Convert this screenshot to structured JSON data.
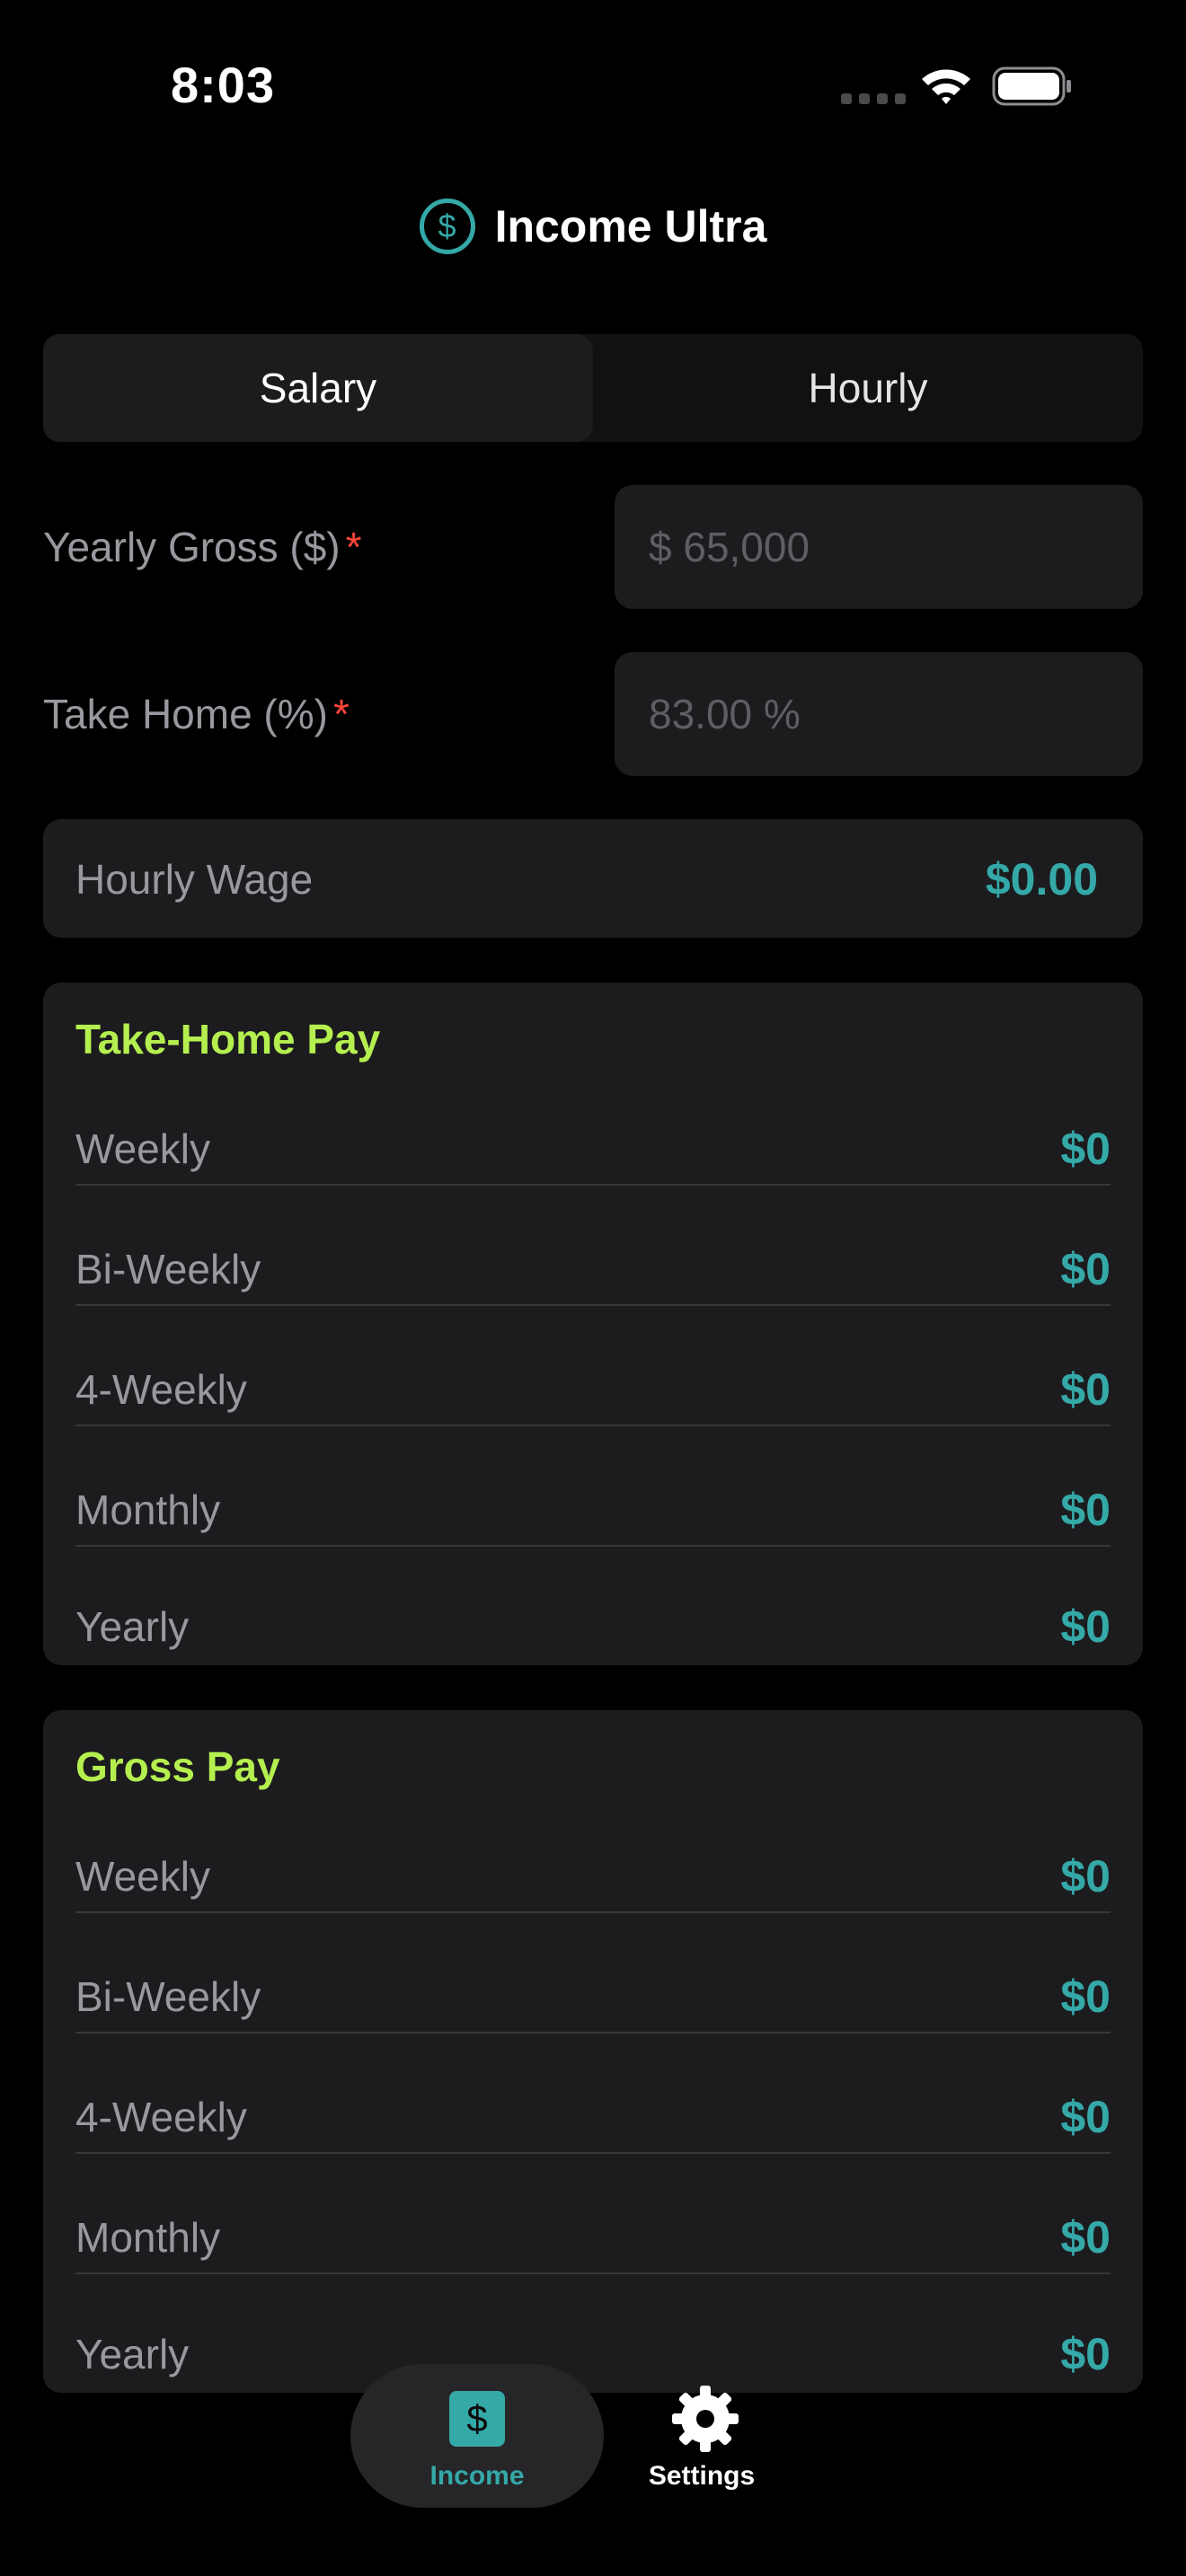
{
  "status_bar": {
    "time": "8:03"
  },
  "header": {
    "title": "Income Ultra",
    "icon": "dollar-circle-icon"
  },
  "segment": {
    "salary_label": "Salary",
    "hourly_label": "Hourly",
    "selected": "Salary"
  },
  "fields": {
    "yearly_gross": {
      "label": "Yearly Gross ($)",
      "required_mark": "*",
      "placeholder": "$ 65,000"
    },
    "take_home": {
      "label": "Take Home (%)",
      "required_mark": "*",
      "placeholder": "83.00 %"
    }
  },
  "hourly_wage": {
    "label": "Hourly Wage",
    "value": "$0.00"
  },
  "take_home_pay": {
    "title": "Take-Home Pay",
    "rows": [
      {
        "label": "Weekly",
        "value": "$0"
      },
      {
        "label": "Bi-Weekly",
        "value": "$0"
      },
      {
        "label": "4-Weekly",
        "value": "$0"
      },
      {
        "label": "Monthly",
        "value": "$0"
      },
      {
        "label": "Yearly",
        "value": "$0"
      }
    ]
  },
  "gross_pay": {
    "title": "Gross Pay",
    "rows": [
      {
        "label": "Weekly",
        "value": "$0"
      },
      {
        "label": "Bi-Weekly",
        "value": "$0"
      },
      {
        "label": "4-Weekly",
        "value": "$0"
      },
      {
        "label": "Monthly",
        "value": "$0"
      },
      {
        "label": "Yearly",
        "value": "$0"
      }
    ]
  },
  "tab_bar": {
    "income": {
      "label": "Income",
      "icon": "dollar-square-icon",
      "icon_glyph": "$"
    },
    "settings": {
      "label": "Settings",
      "icon": "gear-icon"
    }
  },
  "colors": {
    "accent": "#35a8a8",
    "section_title": "#b5ef4f",
    "required": "#ff453a",
    "background": "#000000",
    "card": "#1c1c1e"
  }
}
